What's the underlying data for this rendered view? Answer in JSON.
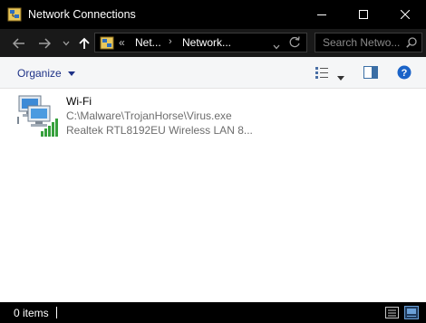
{
  "window": {
    "title": "Network Connections",
    "icons": {
      "app": "network-connections-icon",
      "minimize": "minimize-icon",
      "maximize": "maximize-icon",
      "close": "close-icon"
    }
  },
  "address_bar": {
    "overflow_label": "«",
    "crumbs": [
      "Net...",
      "Network..."
    ],
    "separator": "›",
    "icons": {
      "back": "back-arrow-icon",
      "forward": "forward-arrow-icon",
      "recent": "chevron-down-icon",
      "up": "up-arrow-icon",
      "history": "chevron-down-icon",
      "refresh": "refresh-icon"
    }
  },
  "search": {
    "placeholder": "Search Netwo...",
    "icon": "search-icon"
  },
  "toolbar": {
    "organize_label": "Organize",
    "icons": {
      "view": "change-view-icon",
      "view_menu": "chevron-down-icon",
      "preview": "preview-pane-icon",
      "help": "help-icon"
    }
  },
  "items": [
    {
      "name": "Wi-Fi",
      "detail": "C:\\Malware\\TrojanHorse\\Virus.exe",
      "device": "Realtek RTL8192EU Wireless LAN 8...",
      "icon": "wifi-adapter-icon"
    }
  ],
  "status": {
    "count_label": "0 items",
    "icons": {
      "details_view": "details-view-icon",
      "large_icons_view": "large-icons-view-icon"
    }
  },
  "colors": {
    "titlebar": "#000000",
    "address_bar": "#191919",
    "accent_link": "#1e3287",
    "help": "#1a63c8",
    "signal": "#36a03c"
  }
}
